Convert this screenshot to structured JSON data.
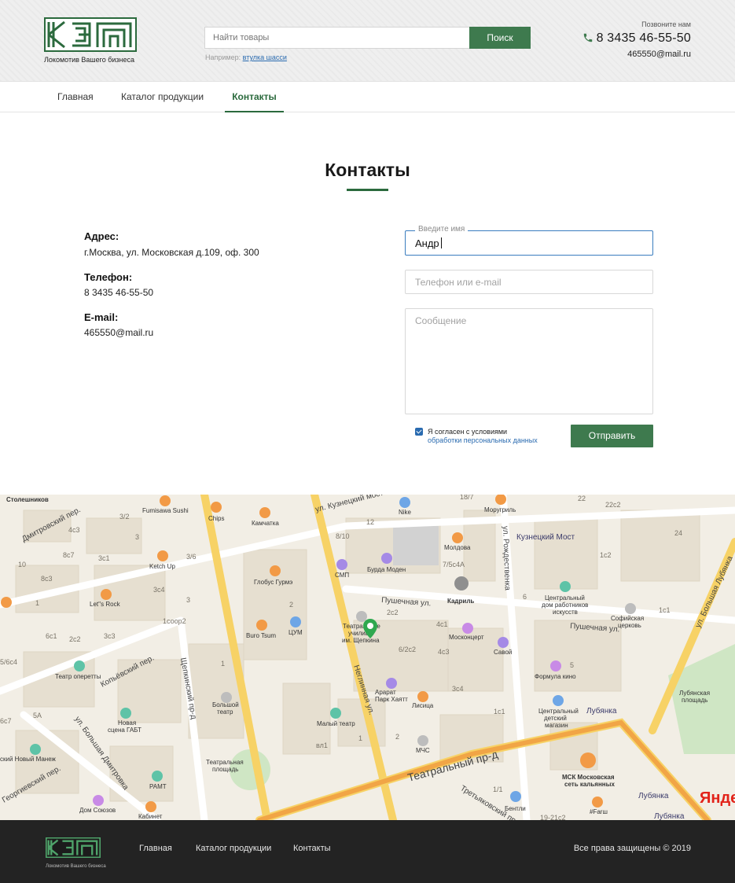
{
  "header": {
    "logo_tagline": "Локомотив Вашего бизнеса",
    "search_placeholder": "Найти товары",
    "search_button": "Поиск",
    "search_hint_prefix": "Например:",
    "search_hint_link": "втулка шасси",
    "call_label": "Позвоните нам",
    "phone": "8 3435 46-55-50",
    "email": "465550@mail.ru"
  },
  "nav": {
    "items": [
      {
        "label": "Главная"
      },
      {
        "label": "Каталог продукции"
      },
      {
        "label": "Контакты"
      }
    ],
    "active": "Контакты"
  },
  "contacts": {
    "title": "Контакты",
    "address_label": "Адрес:",
    "address_value": "г.Москва, ул. Московская д.109, оф. 300",
    "phone_label": "Телефон:",
    "phone_value": "8 3435 46-55-50",
    "email_label": "E-mail:",
    "email_value": "465550@mail.ru"
  },
  "form": {
    "name_label": "Введите имя",
    "name_value": "Андр",
    "contact_placeholder": "Телефон или e-mail",
    "message_placeholder": "Сообщение",
    "agree_text": "Я согласен с условиями",
    "agree_link": "обработки персональных данных",
    "agree_checked": true,
    "submit": "Отправить"
  },
  "map": {
    "streets": [
      "ул. Кузнецкий мост",
      "Пушечная ул.",
      "Неглинная ул.",
      "Театральный пр-д",
      "Щепкинский пр-д",
      "Копьёвский пер.",
      "ул. Большая Дмитровка",
      "ул. Рождественка",
      "ул. Большая Лубянка",
      "Дмитровский пер.",
      "Георгиевский пер.",
      "Третьяковский пр-д"
    ],
    "places": [
      "Столешников",
      "Fumisawa Sushi",
      "Chips",
      "Камчатка",
      "Nike",
      "Моругриль",
      "Молдова",
      "Кузнецкий Мост",
      "Ketch Up",
      "Глобус Гурмэ",
      "Бурда Моден",
      "СМП",
      "Let's Rock",
      "Кадриль",
      "Центральный дом работников искусств",
      "Софийская церковь",
      "Buro Tsum",
      "ЦУМ",
      "Театральное училище им. Щепкина",
      "Москонцерт",
      "Савой",
      "Театр оперетты",
      "Большой театр",
      "Арарат Парк Хаятт",
      "Лисица",
      "Формула кино",
      "Новая сцена ГАБТ",
      "Малый театр",
      "МЧС",
      "Центральный детский магазин",
      "Лубянка",
      "Лубянская площадь",
      "Новый Манеж",
      "Театральная площадь",
      "РАМТ",
      "МСК Московская сеть кальянных",
      "Дом Союзов",
      "Кабинет",
      "Бентли",
      "#Farш"
    ],
    "building_numbers": [
      "18/7",
      "22",
      "22с2",
      "3/2",
      "4с3",
      "3",
      "12",
      "8/10",
      "24",
      "8с7",
      "3с1",
      "3/6",
      "7/5с4А",
      "1с2",
      "10",
      "8с3",
      "3с4",
      "4с3",
      "2",
      "6",
      "1",
      "1с1",
      "1соор2",
      "2с2",
      "4с1",
      "6с1",
      "2с2",
      "3с3",
      "6/2с2",
      "4с3",
      "5",
      "5/6с4",
      "1",
      "3с4",
      "6с7",
      "5А",
      "1с1",
      "вл1",
      "1",
      "2",
      "1/1",
      "19-21с2"
    ],
    "watermark": "Яндекс"
  },
  "footer": {
    "tagline": "Локомотив Вашего бизнеса",
    "links": [
      "Главная",
      "Каталог продукции",
      "Контакты"
    ],
    "copyright": "Все права защищены ©  2019"
  },
  "colors": {
    "brand_green": "#2b6a3d",
    "button_green": "#3e7a4e",
    "link_blue": "#2a6bb0",
    "footer_bg": "#232323"
  }
}
